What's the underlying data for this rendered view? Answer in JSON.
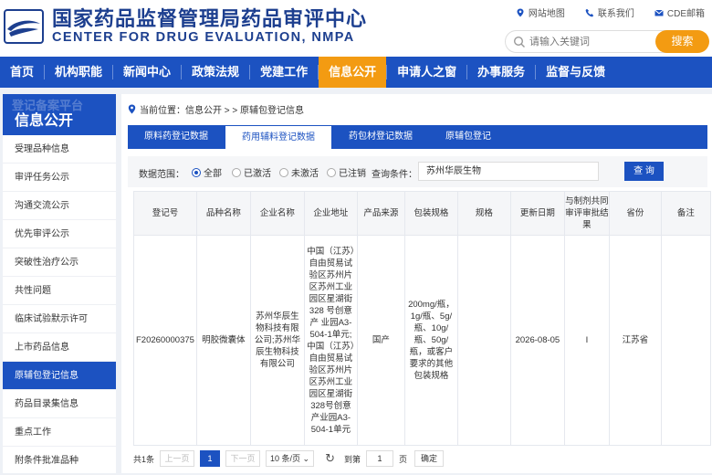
{
  "header": {
    "title_cn": "国家药品监督管理局药品审评中心",
    "title_en": "CENTER FOR DRUG EVALUATION, NMPA",
    "links": [
      {
        "label": "网站地图",
        "icon": "map-pin-icon"
      },
      {
        "label": "联系我们",
        "icon": "phone-icon"
      },
      {
        "label": "CDE邮箱",
        "icon": "mail-icon"
      }
    ],
    "search_placeholder": "请输入关键词",
    "search_button": "搜索"
  },
  "nav": {
    "items": [
      "首页",
      "机构职能",
      "新闻中心",
      "政策法规",
      "党建工作",
      "信息公开",
      "申请人之窗",
      "办事服务",
      "监督与反馈"
    ],
    "active_index": 5
  },
  "sidebar": {
    "ghost": "登记备案平台",
    "title": "信息公开",
    "items": [
      "受理品种信息",
      "审评任务公示",
      "沟通交流公示",
      "优先审评公示",
      "突破性治疗公示",
      "共性问题",
      "临床试验默示许可",
      "上市药品信息",
      "原辅包登记信息",
      "药品目录集信息",
      "重点工作",
      "附条件批准品种"
    ],
    "active_index": 8
  },
  "breadcrumb": {
    "text": "当前位置：信息公开 > > 原辅包登记信息"
  },
  "tabs": {
    "items": [
      "原料药登记数据",
      "药用辅料登记数据",
      "药包材登记数据",
      "原辅包登记"
    ],
    "active_index": 1
  },
  "filter": {
    "scope_label": "数据范围：",
    "options": [
      "全部",
      "已激活",
      "未激活",
      "已注销"
    ],
    "selected_index": 0,
    "condition_label": "查询条件：",
    "condition_value": "苏州华辰生物",
    "query_button": "查 询"
  },
  "table": {
    "headers": [
      "登记号",
      "品种名称",
      "企业名称",
      "企业地址",
      "产品来源",
      "包装规格",
      "规格",
      "更新日期",
      "与制剂共同审评审批结果",
      "省份",
      "备注"
    ],
    "rows": [
      [
        "F20260000375",
        "明胶微囊体",
        "苏州华辰生物科技有限公司;苏州华辰生物科技有限公司",
        "中国（江苏）自由贸易试验区苏州片区苏州工业园区星湖街 328 号创意产 业园A3-504-1单元;中国（江苏）自由贸易试验区苏州片区苏州工业园区星湖街328号创意产业园A3-504-1单元",
        "国产",
        "200mg/瓶，1g/瓶、5g/瓶、10g/瓶、50g/瓶，或客户要求的其他包装规格",
        "",
        "2026-08-05",
        "I",
        "江苏省",
        ""
      ]
    ]
  },
  "pager": {
    "total": "共1条",
    "prev": "上一页",
    "page": "1",
    "next": "下一页",
    "page_size": "10 条/页",
    "goto_label": "到第",
    "goto_value": "1",
    "page_suffix": "页",
    "confirm": "确定"
  },
  "colors": {
    "brand_blue": "#1c52c1",
    "accent_orange": "#f39b12",
    "title_blue": "#1d3f8f"
  }
}
